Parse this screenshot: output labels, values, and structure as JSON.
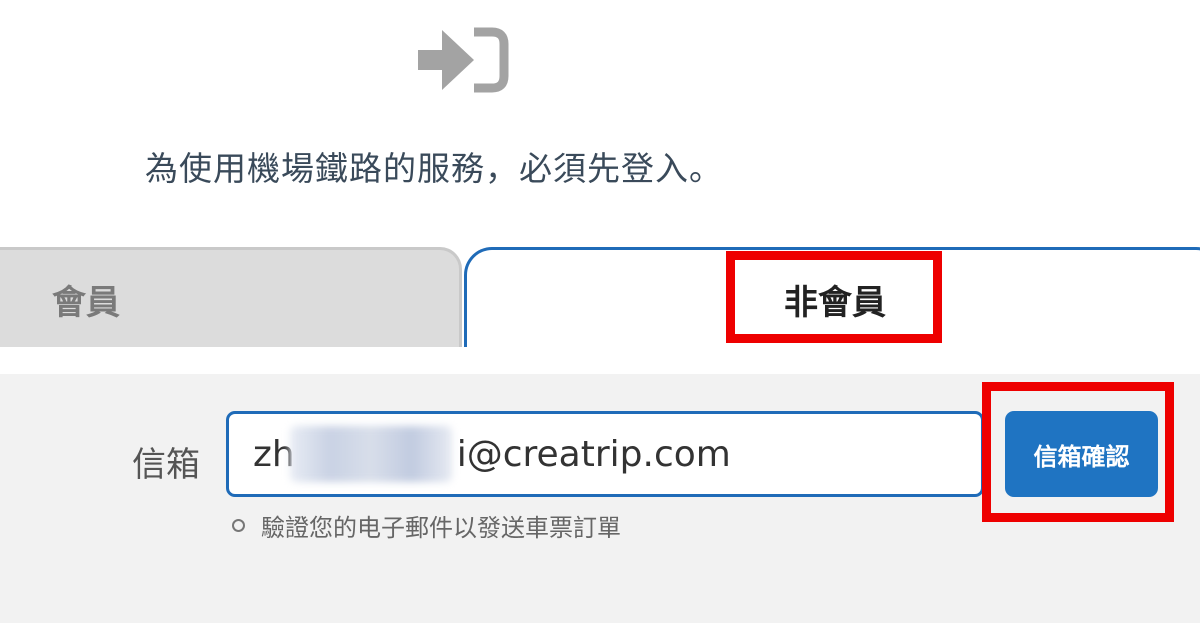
{
  "login_icon": "sign-in-icon",
  "intro": {
    "text": "為使用機場鐵路的服務，必須先登入。"
  },
  "tabs": [
    {
      "label": "會員",
      "active": false
    },
    {
      "label": "非會員",
      "active": true
    }
  ],
  "form": {
    "email_label": "信箱",
    "email_value_prefix": "zh",
    "email_value_suffix": "i@creatrip.com",
    "confirm_button": "信箱確認",
    "hint": "驗證您的电子郵件以發送車票訂單"
  },
  "colors": {
    "accent": "#1f6bb8",
    "button": "#1f74c2",
    "highlight": "#ee0000",
    "inactive_tab": "#dcdcdc",
    "panel": "#f2f2f2"
  }
}
